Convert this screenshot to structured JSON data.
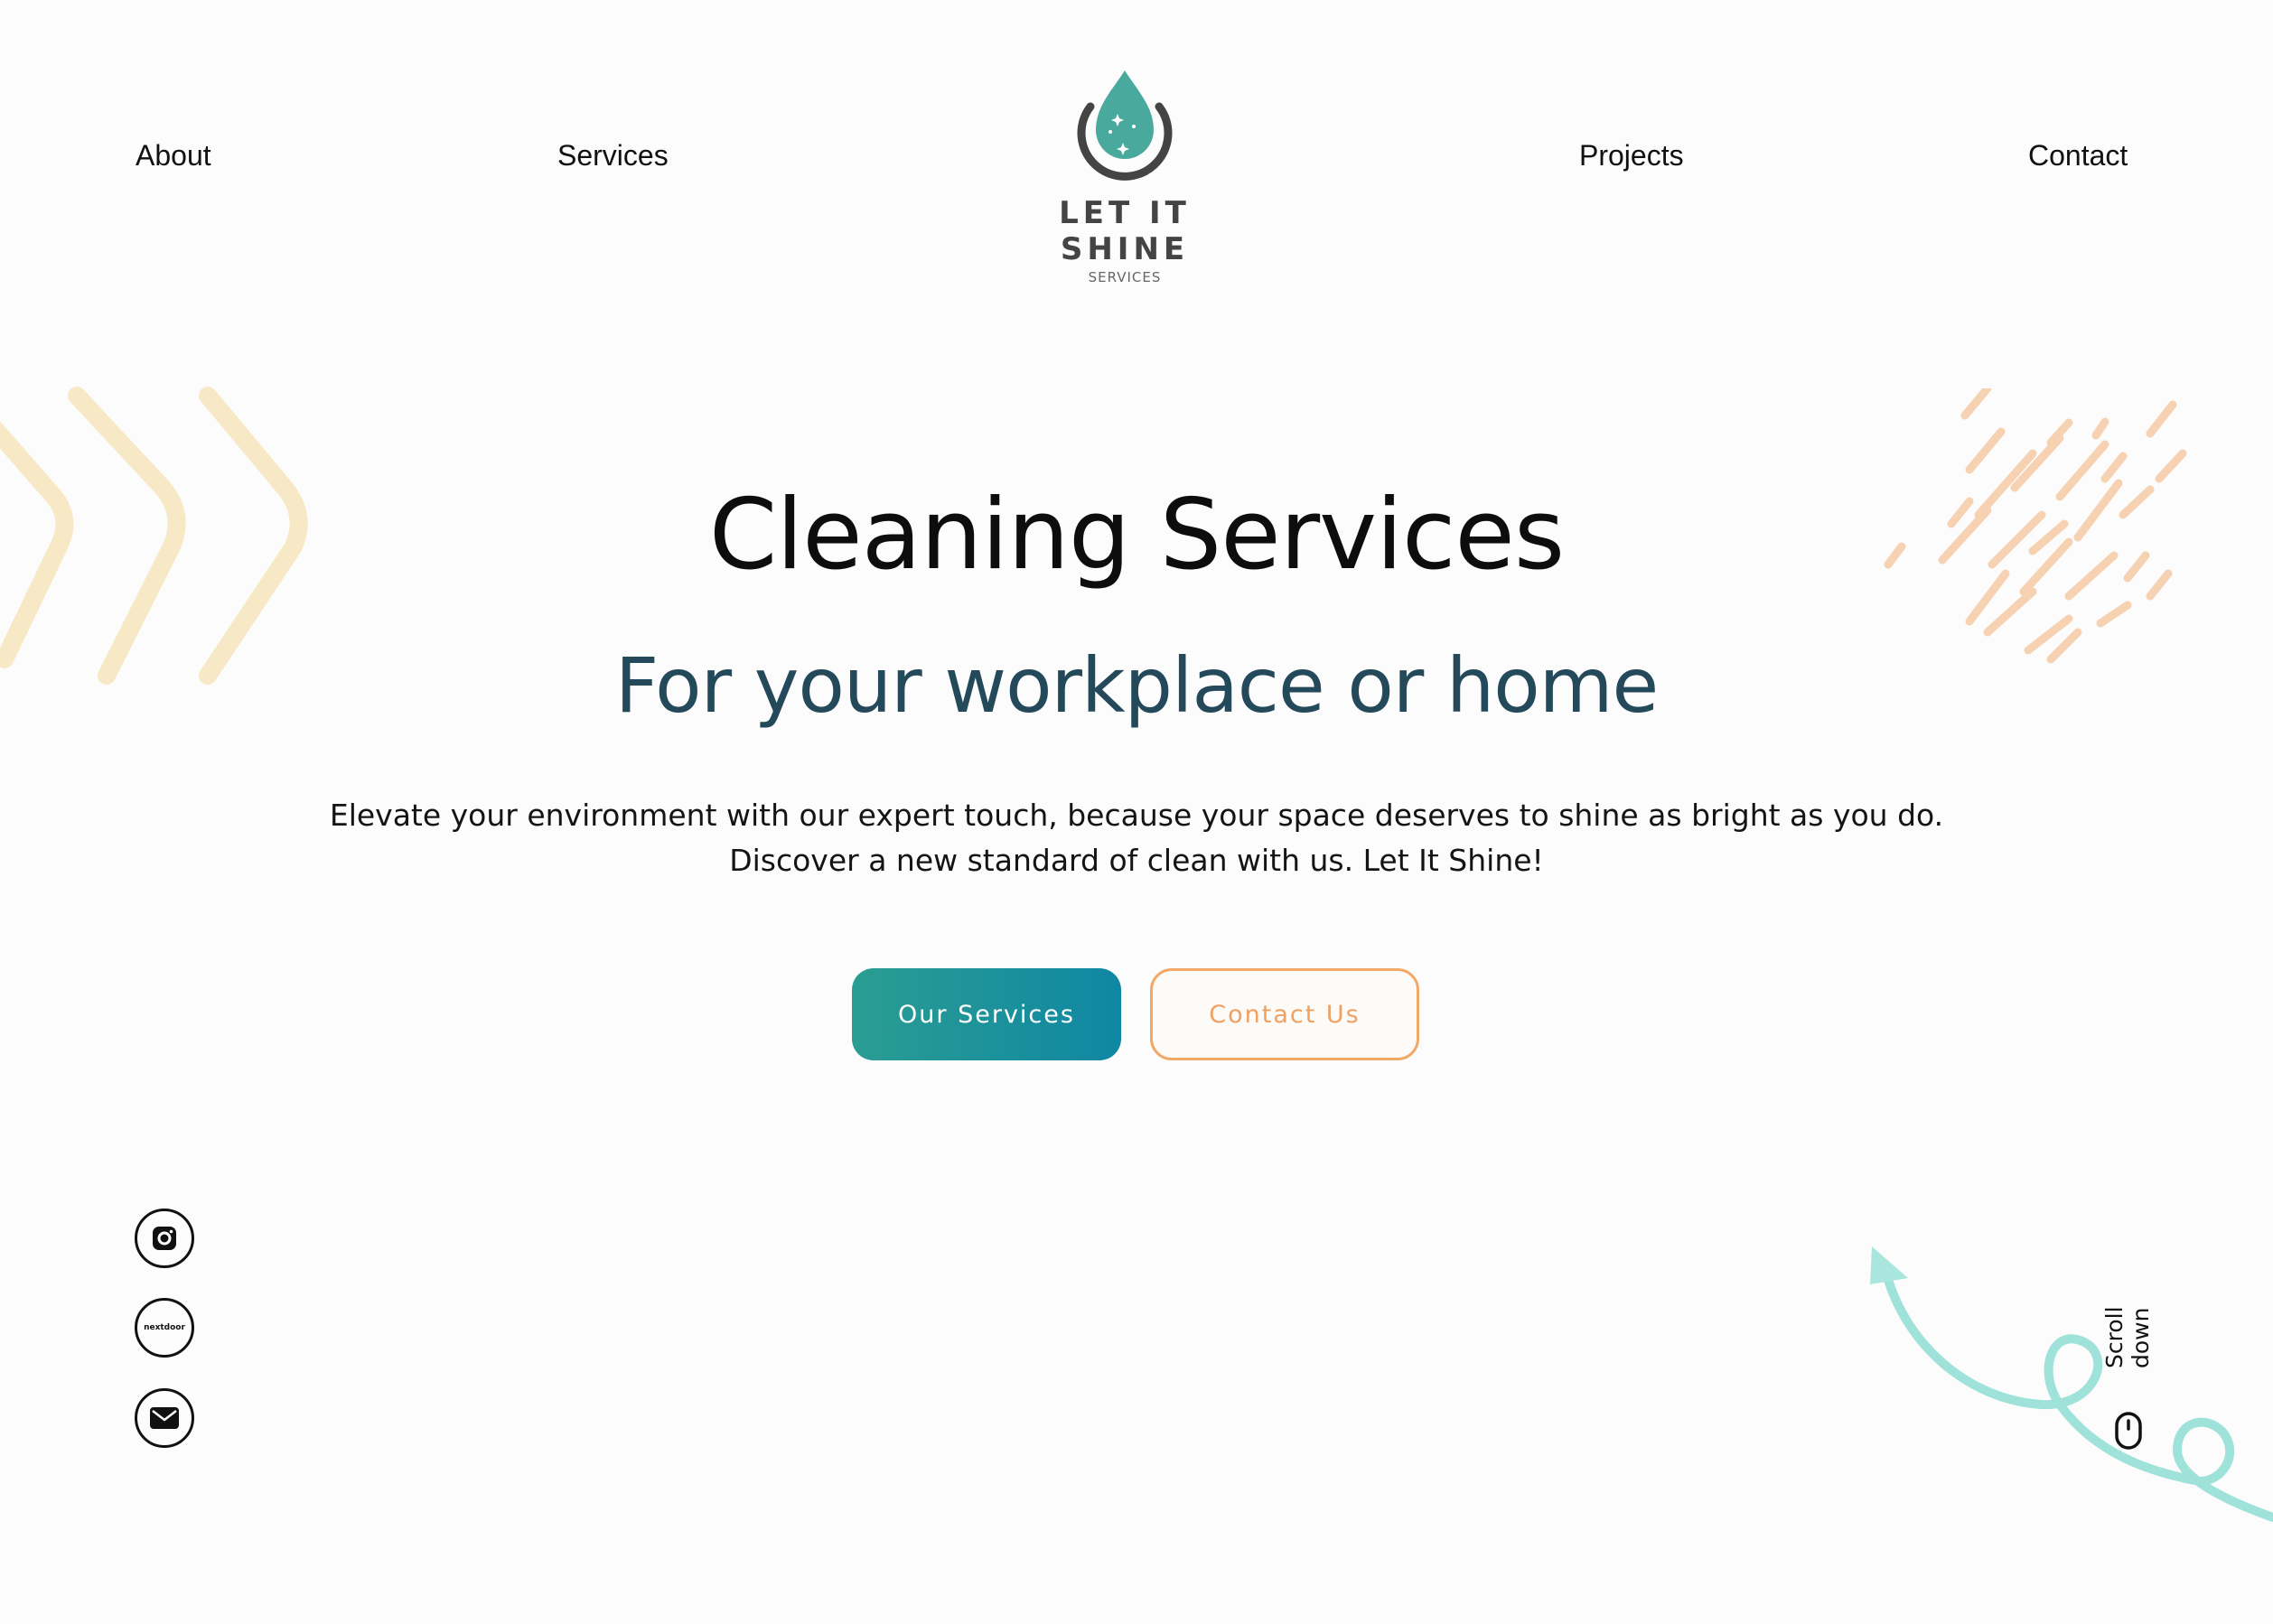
{
  "nav": {
    "about": "About",
    "services": "Services",
    "projects": "Projects",
    "contact": "Contact"
  },
  "logo": {
    "title": "LET IT SHINE",
    "subtitle": "SERVICES",
    "icon": "water-drop-icon"
  },
  "hero": {
    "title": "Cleaning Services",
    "subtitle": "For your workplace or home",
    "description": "Elevate your environment with our expert touch, because your space deserves to shine as bright as you do. Discover a new standard of clean with us. Let It Shine!"
  },
  "buttons": {
    "primary": "Our Services",
    "secondary": "Contact Us"
  },
  "socials": [
    {
      "name": "instagram",
      "icon": "instagram-icon"
    },
    {
      "name": "nextdoor",
      "label": "nextdoor",
      "icon": "nextdoor-icon"
    },
    {
      "name": "email",
      "icon": "mail-icon"
    }
  ],
  "scroll": {
    "label": "Scroll down",
    "icon": "mouse-icon"
  },
  "colors": {
    "accent_teal": "#2a9d92",
    "accent_blue": "#0f87a3",
    "accent_orange": "#f2a868",
    "subtitle": "#24495a",
    "chevron": "#f7e9c6",
    "dashes": "#f6d2b3",
    "swirl": "#9fe2da"
  }
}
